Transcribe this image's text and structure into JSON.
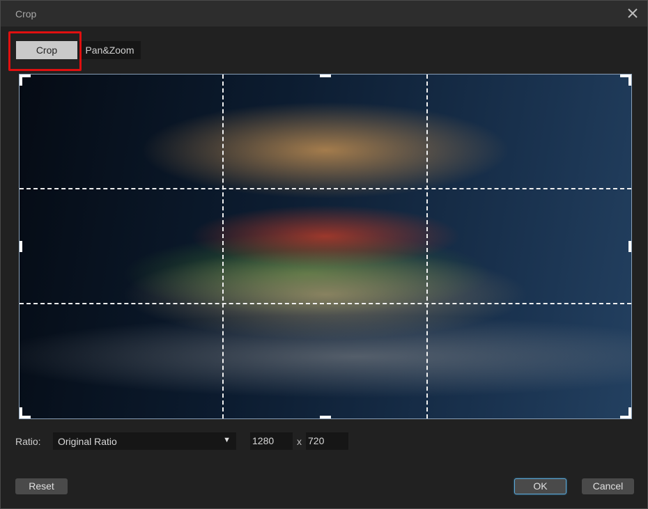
{
  "window": {
    "title": "Crop",
    "close_icon": "close-icon"
  },
  "tabs": [
    {
      "label": "Crop",
      "active": true,
      "highlighted": true
    },
    {
      "label": "Pan&Zoom",
      "active": false
    }
  ],
  "preview": {
    "description": "Hamburger on a plate, dark blue background",
    "grid": "rule-of-thirds dashed",
    "crop_selection": "full frame"
  },
  "ratio": {
    "label": "Ratio:",
    "selected": "Original Ratio",
    "width": "1280",
    "separator": "x",
    "height": "720"
  },
  "buttons": {
    "reset": "Reset",
    "ok": "OK",
    "cancel": "Cancel"
  },
  "colors": {
    "highlight": "#e01010",
    "ok_focus": "#5fa9d6"
  }
}
